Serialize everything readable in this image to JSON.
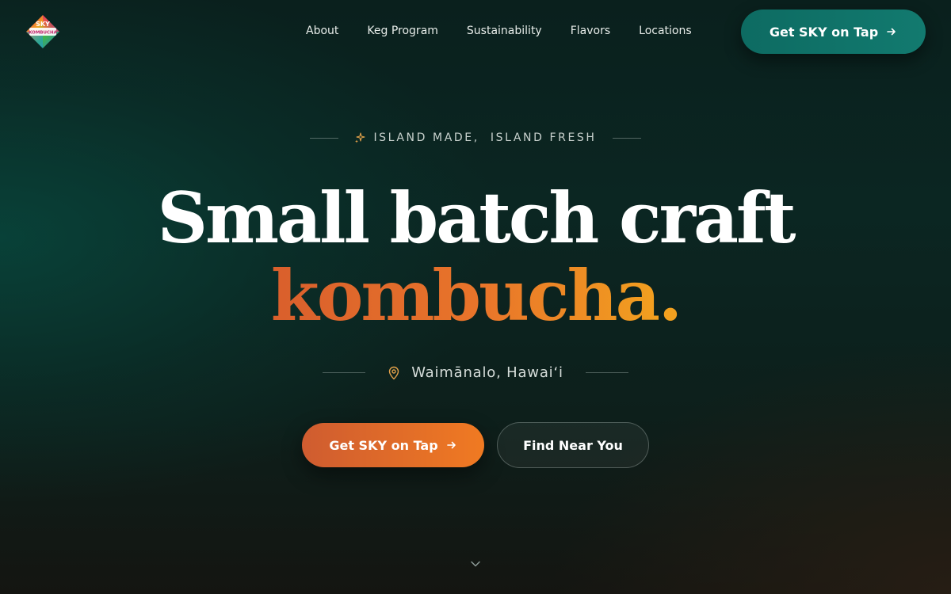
{
  "brand": {
    "logo_text_line1": "SKY",
    "logo_text_line2": "KOMBUCHA"
  },
  "nav": {
    "items": [
      {
        "label": "About"
      },
      {
        "label": "Keg Program"
      },
      {
        "label": "Sustainability"
      },
      {
        "label": "Flavors"
      },
      {
        "label": "Locations"
      }
    ],
    "cta_label": "Get SKY on Tap"
  },
  "hero": {
    "eyebrow": "ISLAND MADE,  ISLAND FRESH",
    "headline_line1": "Small batch craft",
    "headline_accent": "kombucha",
    "headline_dot": ".",
    "location": "Waimānalo, Hawaiʻi",
    "primary_button": "Get SKY on Tap",
    "secondary_button": "Find Near You"
  },
  "colors": {
    "teal_cta": "#127a6f",
    "orange_start": "#cf5c30",
    "orange_end": "#f07a22",
    "accent_gold": "#f2a01f"
  },
  "icons": {
    "arrow": "arrow-right-icon",
    "sparkle": "sparkle-icon",
    "pin": "map-pin-icon",
    "scroll": "chevron-down-icon"
  }
}
